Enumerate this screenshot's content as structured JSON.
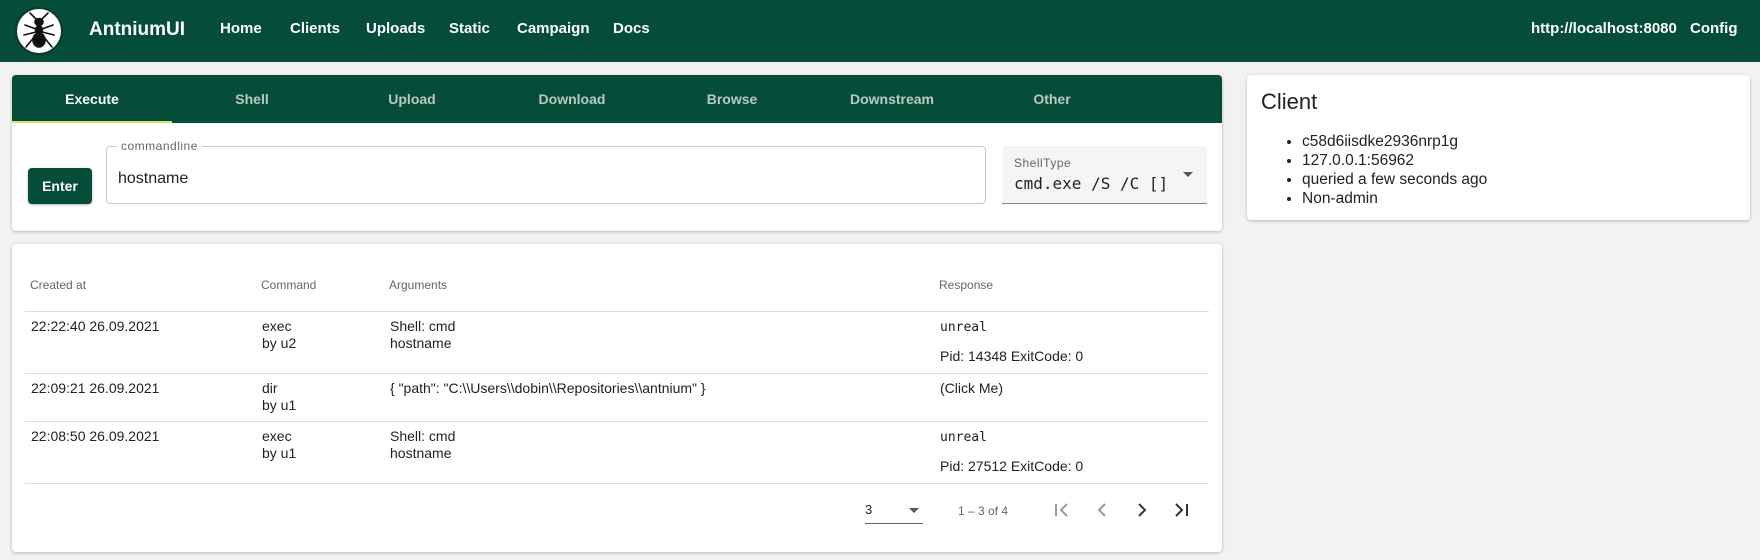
{
  "app": {
    "brand": "AntniumUI"
  },
  "nav": {
    "items": [
      "Home",
      "Clients",
      "Uploads",
      "Static",
      "Campaign",
      "Docs"
    ],
    "server": "http://localhost:8080",
    "config": "Config"
  },
  "tabs": [
    "Execute",
    "Shell",
    "Upload",
    "Download",
    "Browse",
    "Downstream",
    "Other"
  ],
  "execute": {
    "enter_label": "Enter",
    "commandline_label": "commandline",
    "commandline_value": "hostname",
    "shelltype_label": "ShellType",
    "shelltype_value": "cmd.exe /S /C []"
  },
  "table": {
    "headers": [
      "Created at",
      "Command",
      "Arguments",
      "Response"
    ],
    "rows": [
      {
        "created": "22:22:40 26.09.2021",
        "command": "exec",
        "by": "by u2",
        "args": [
          "Shell: cmd",
          "hostname"
        ],
        "response": "unreal",
        "status": "Pid: 14348 ExitCode: 0"
      },
      {
        "created": "22:09:21 26.09.2021",
        "command": "dir",
        "by": "by u1",
        "args": [
          "{ \"path\": \"C:\\\\Users\\\\dobin\\\\Repositories\\\\antnium\" }"
        ],
        "response": "(Click Me)",
        "status": ""
      },
      {
        "created": "22:08:50 26.09.2021",
        "command": "exec",
        "by": "by u1",
        "args": [
          "Shell: cmd",
          "hostname"
        ],
        "response": "unreal",
        "status": "Pid: 27512 ExitCode: 0"
      }
    ],
    "pager": {
      "page_size": "3",
      "range": "1 – 3 of 4"
    }
  },
  "client": {
    "title": "Client",
    "details": [
      "c58d6iisdke2936nrp1g",
      "127.0.0.1:56962",
      "queried a few seconds ago",
      "Non-admin"
    ]
  },
  "colors": {
    "primary": "#054d38",
    "tab_indicator": "#d8e36a"
  },
  "icons": [
    "ant-logo-icon",
    "chevron-down-icon",
    "first-page-icon",
    "prev-page-icon",
    "next-page-icon",
    "last-page-icon"
  ]
}
